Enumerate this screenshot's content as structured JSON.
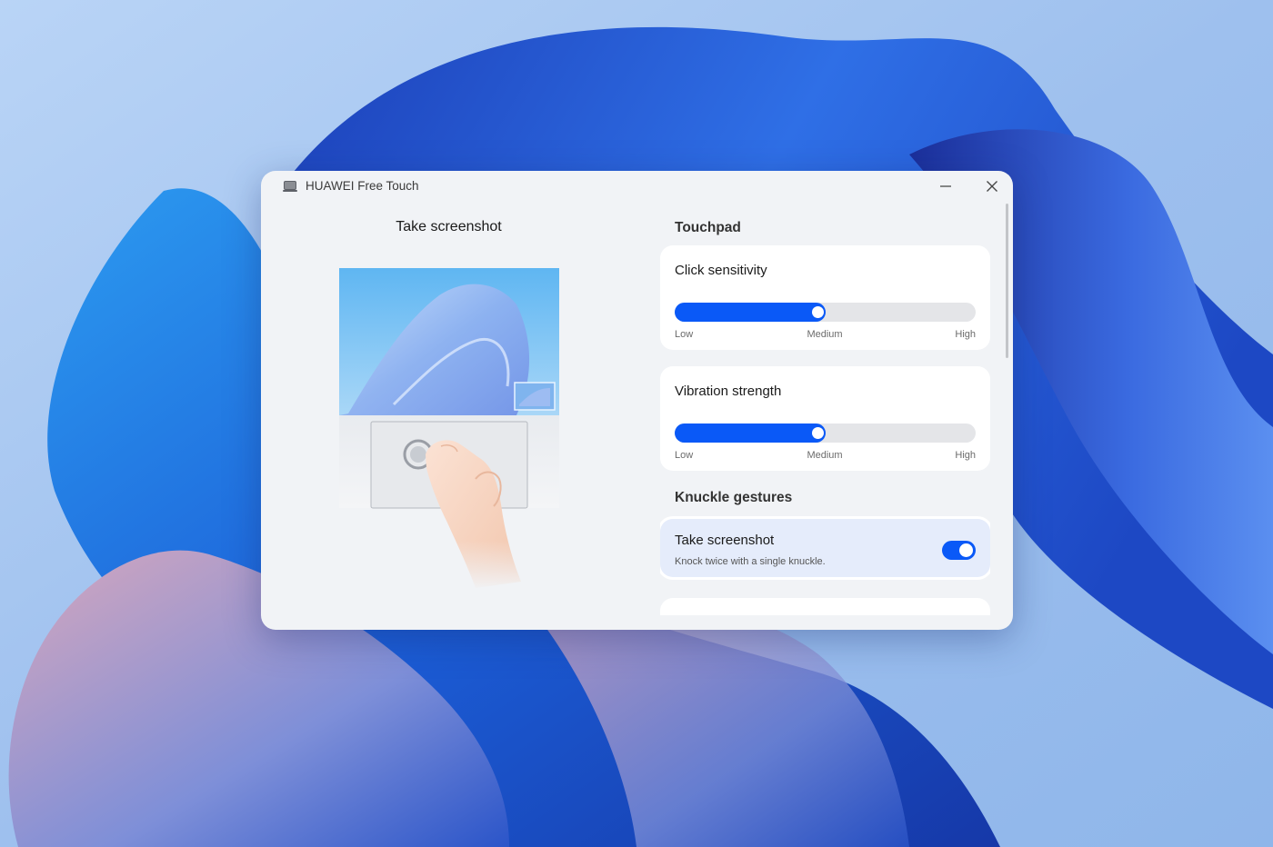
{
  "window": {
    "title": "HUAWEI Free Touch",
    "controls": [
      "minimize-icon",
      "close-icon"
    ]
  },
  "left_panel": {
    "title": "Take screenshot"
  },
  "touchpad": {
    "section_title": "Touchpad",
    "click_sensitivity": {
      "label": "Click sensitivity",
      "value_fraction": 0.5,
      "ticks": {
        "low": "Low",
        "medium": "Medium",
        "high": "High"
      }
    },
    "vibration_strength": {
      "label": "Vibration strength",
      "value_fraction": 0.5,
      "ticks": {
        "low": "Low",
        "medium": "Medium",
        "high": "High"
      }
    }
  },
  "knuckle_gestures": {
    "section_title": "Knuckle gestures",
    "take_screenshot": {
      "title": "Take screenshot",
      "subtitle": "Knock twice with a single knuckle.",
      "enabled": true
    }
  },
  "colors": {
    "accent": "#0a59f7",
    "window_bg": "#f1f3f6",
    "card_bg": "#ffffff",
    "highlight_card_bg": "#e5ecfb"
  }
}
